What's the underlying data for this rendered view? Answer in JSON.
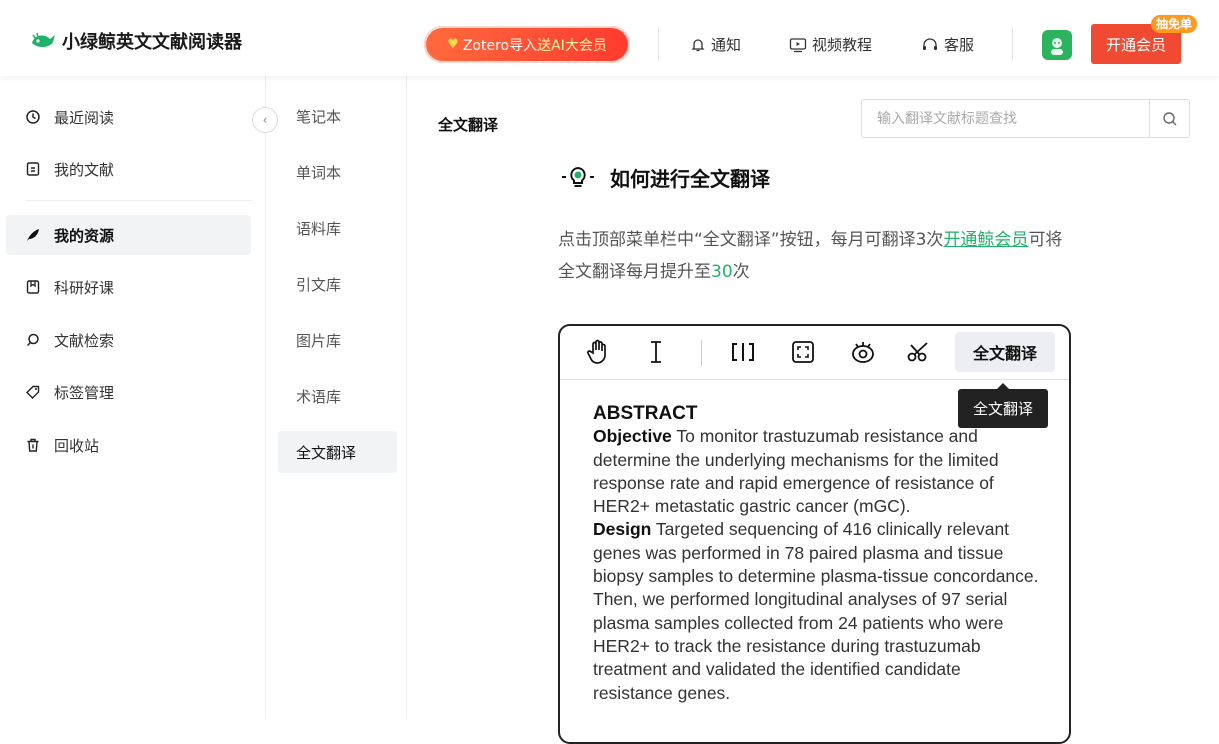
{
  "header": {
    "app_name": "小绿鲸英文文献阅读器",
    "promo_prefix": "Zotero导入",
    "promo_highlight": "送AI大会员",
    "nav": [
      {
        "label": "通知",
        "icon": "bell-icon"
      },
      {
        "label": "视频教程",
        "icon": "video-icon"
      },
      {
        "label": "客服",
        "icon": "headset-icon"
      }
    ],
    "vip_button": "开通会员",
    "vip_badge": "抽免单"
  },
  "sidebar": {
    "items": [
      {
        "label": "最近阅读",
        "icon": "clock-icon"
      },
      {
        "label": "我的文献",
        "icon": "document-icon"
      },
      {
        "label": "我的资源",
        "icon": "feather-icon",
        "active": true
      },
      {
        "label": "科研好课",
        "icon": "bookmark-icon"
      },
      {
        "label": "文献检索",
        "icon": "search-icon"
      },
      {
        "label": "标签管理",
        "icon": "tag-icon"
      },
      {
        "label": "回收站",
        "icon": "trash-icon"
      }
    ]
  },
  "subnav": {
    "items": [
      "笔记本",
      "单词本",
      "语料库",
      "引文库",
      "图片库",
      "术语库",
      "全文翻译"
    ],
    "active": "全文翻译"
  },
  "main": {
    "title": "全文翻译",
    "search_placeholder": "输入翻译文献标题查找",
    "howto_title": "如何进行全文翻译",
    "desc_part1": "点击顶部菜单栏中“全文翻译”按钮，每月可翻译3次",
    "desc_link": "开通鲸会员",
    "desc_part2": "可将全文翻译每月提升至",
    "desc_number": "30",
    "desc_part3": "次"
  },
  "demo": {
    "toolbar_translate": "全文翻译",
    "tooltip": "全文翻译",
    "abstract_heading": "ABSTRACT",
    "objective_label": "Objective",
    "objective_text": " To monitor trastuzumab resistance and determine the underlying mechanisms for the limited response rate and rapid emergence of resistance of HER2+ metastatic gastric cancer (mGC).",
    "design_label": "Design",
    "design_text": " Targeted sequencing of 416 clinically relevant genes was performed in 78 paired plasma and tissue biopsy samples to determine plasma-tissue concordance. Then, we performed longitudinal analyses of 97 serial plasma samples collected from 24 patients who were HER2+ to track the resistance during trastuzumab treatment and validated the identified candidate resistance genes."
  },
  "colors": {
    "accent_green": "#21b26a",
    "vip_red": "#f04a32",
    "badge_orange": "#ff9a1f"
  }
}
